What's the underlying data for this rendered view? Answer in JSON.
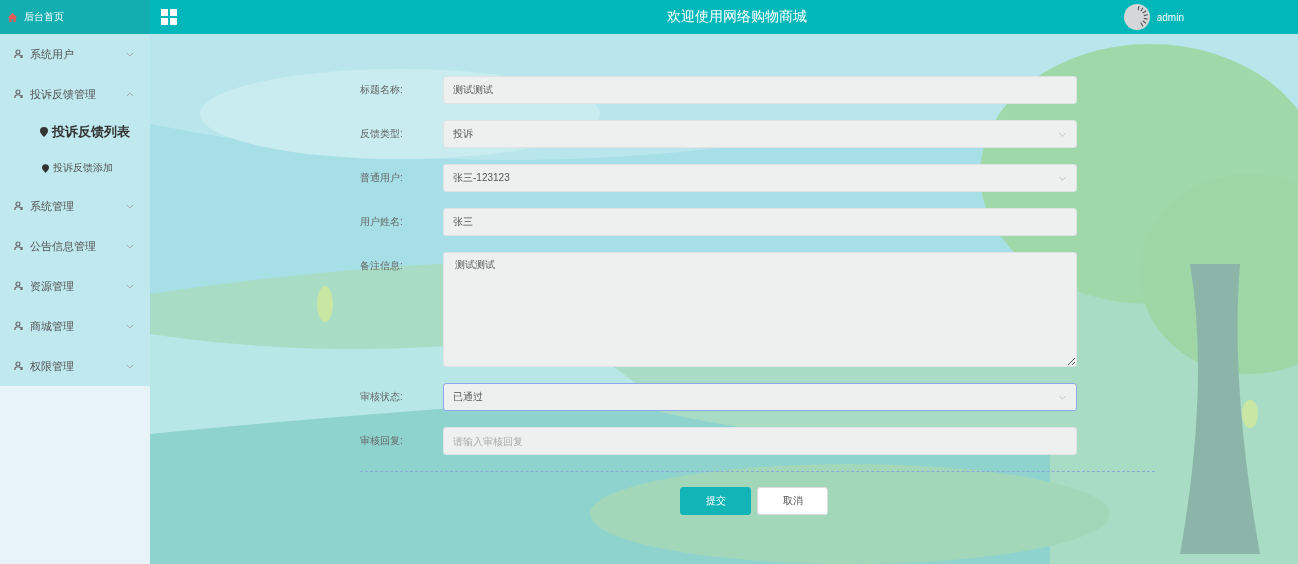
{
  "sidebar": {
    "home": "后台首页",
    "items": [
      {
        "label": "系统用户",
        "expanded": false
      },
      {
        "label": "投诉反馈管理",
        "expanded": true,
        "children": [
          {
            "label": "投诉反馈列表",
            "selected": true
          },
          {
            "label": "投诉反馈添加",
            "selected": false
          }
        ]
      },
      {
        "label": "系统管理",
        "expanded": false
      },
      {
        "label": "公告信息管理",
        "expanded": false
      },
      {
        "label": "资源管理",
        "expanded": false
      },
      {
        "label": "商城管理",
        "expanded": false
      },
      {
        "label": "权限管理",
        "expanded": false
      }
    ]
  },
  "header": {
    "title": "欢迎使用网络购物商城",
    "user": "admin"
  },
  "form": {
    "fields": [
      {
        "kind": "text",
        "label": "标题名称:",
        "value": "测试测试",
        "focused": false
      },
      {
        "kind": "select",
        "label": "反馈类型:",
        "value": "投诉",
        "focused": false
      },
      {
        "kind": "select",
        "label": "普通用户:",
        "value": "张三-123123",
        "focused": false
      },
      {
        "kind": "text",
        "label": "用户姓名:",
        "value": "张三",
        "focused": false
      },
      {
        "kind": "textarea",
        "label": "备注信息:",
        "value": "测试测试",
        "focused": false
      },
      {
        "kind": "select",
        "label": "审核状态:",
        "value": "已通过",
        "focused": true
      },
      {
        "kind": "text",
        "label": "审核回复:",
        "placeholder": "请输入审核回复",
        "focused": false
      }
    ],
    "buttons": [
      {
        "kind": "primary",
        "label": "提交"
      },
      {
        "kind": "plain",
        "label": "取消"
      }
    ]
  }
}
